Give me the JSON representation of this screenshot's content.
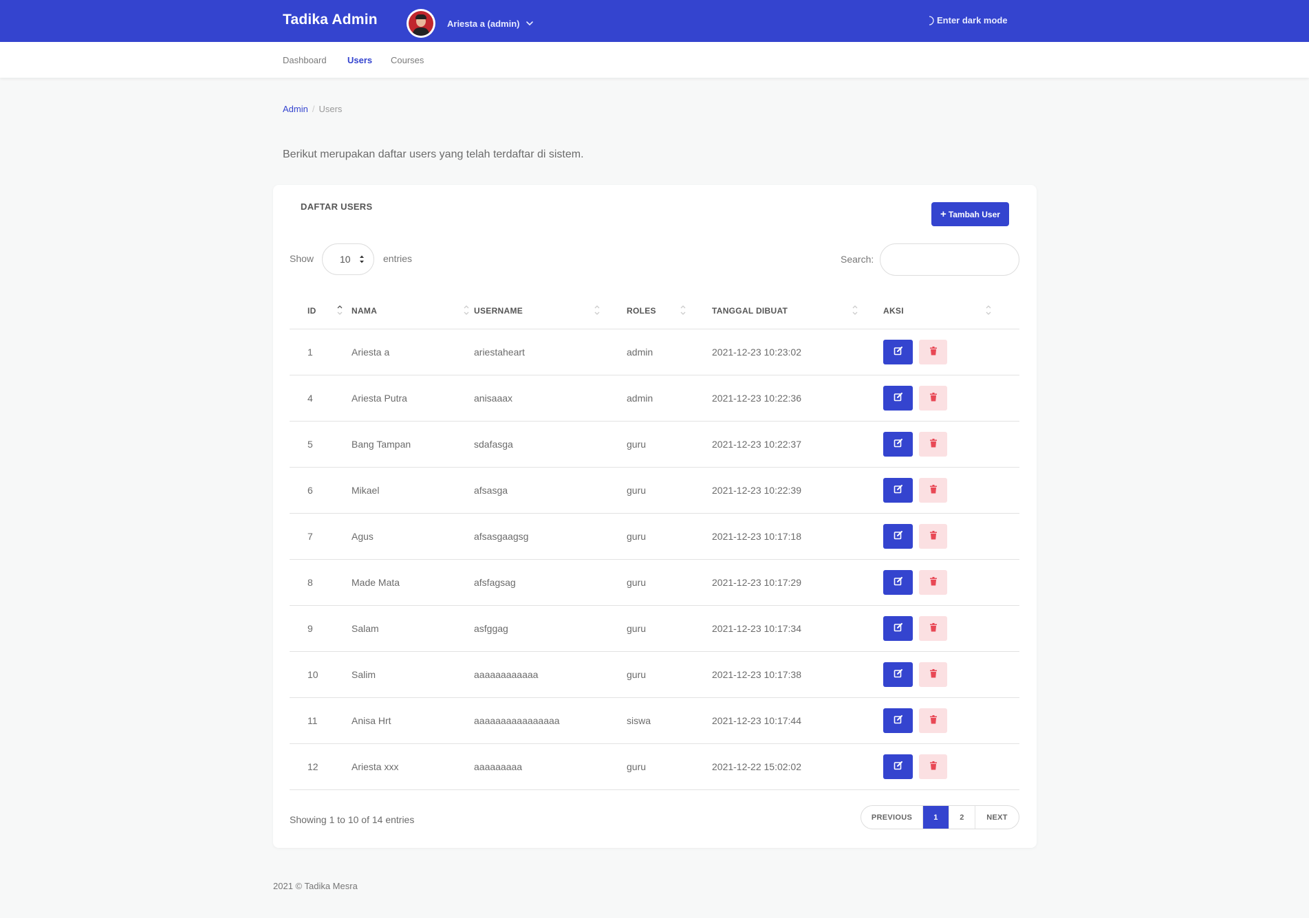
{
  "header": {
    "brand": "Tadika Admin",
    "user_name": "Ariesta a (admin)",
    "dark_mode_label": "Enter dark mode",
    "accent_color": "#3444cf"
  },
  "nav": {
    "items": [
      {
        "label": "Dashboard",
        "active": false
      },
      {
        "label": "Users",
        "active": true
      },
      {
        "label": "Courses",
        "active": false
      }
    ]
  },
  "breadcrumb": {
    "root": "Admin",
    "current": "Users"
  },
  "intro_text": "Berikut merupakan daftar users yang telah terdaftar di sistem.",
  "card": {
    "title": "DAFTAR USERS",
    "add_button_label": "Tambah User",
    "show_label": "Show",
    "entries_label": "entries",
    "page_length": "10",
    "search_label": "Search:",
    "search_value": ""
  },
  "table": {
    "columns": [
      "ID",
      "NAMA",
      "USERNAME",
      "ROLES",
      "TANGGAL DIBUAT",
      "AKSI"
    ],
    "rows": [
      {
        "id": "1",
        "nama": "Ariesta a",
        "username": "ariestaheart",
        "roles": "admin",
        "tanggal": "2021-12-23 10:23:02"
      },
      {
        "id": "4",
        "nama": "Ariesta Putra",
        "username": "anisaaax",
        "roles": "admin",
        "tanggal": "2021-12-23 10:22:36"
      },
      {
        "id": "5",
        "nama": "Bang Tampan",
        "username": "sdafasga",
        "roles": "guru",
        "tanggal": "2021-12-23 10:22:37"
      },
      {
        "id": "6",
        "nama": "Mikael",
        "username": "afsasga",
        "roles": "guru",
        "tanggal": "2021-12-23 10:22:39"
      },
      {
        "id": "7",
        "nama": "Agus",
        "username": "afsasgaagsg",
        "roles": "guru",
        "tanggal": "2021-12-23 10:17:18"
      },
      {
        "id": "8",
        "nama": "Made Mata",
        "username": "afsfagsag",
        "roles": "guru",
        "tanggal": "2021-12-23 10:17:29"
      },
      {
        "id": "9",
        "nama": "Salam",
        "username": "asfggag",
        "roles": "guru",
        "tanggal": "2021-12-23 10:17:34"
      },
      {
        "id": "10",
        "nama": "Salim",
        "username": "aaaaaaaaaaaa",
        "roles": "guru",
        "tanggal": "2021-12-23 10:17:38"
      },
      {
        "id": "11",
        "nama": "Anisa Hrt",
        "username": "aaaaaaaaaaaaaaaa",
        "roles": "siswa",
        "tanggal": "2021-12-23 10:17:44"
      },
      {
        "id": "12",
        "nama": "Ariesta xxx",
        "username": "aaaaaaaaa",
        "roles": "guru",
        "tanggal": "2021-12-22 15:02:02"
      }
    ]
  },
  "table_info": "Showing 1 to 10 of 14 entries",
  "pagination": {
    "previous": "PREVIOUS",
    "pages": [
      "1",
      "2"
    ],
    "active_page": "1",
    "next": "NEXT"
  },
  "footer": "2021 © Tadika Mesra"
}
